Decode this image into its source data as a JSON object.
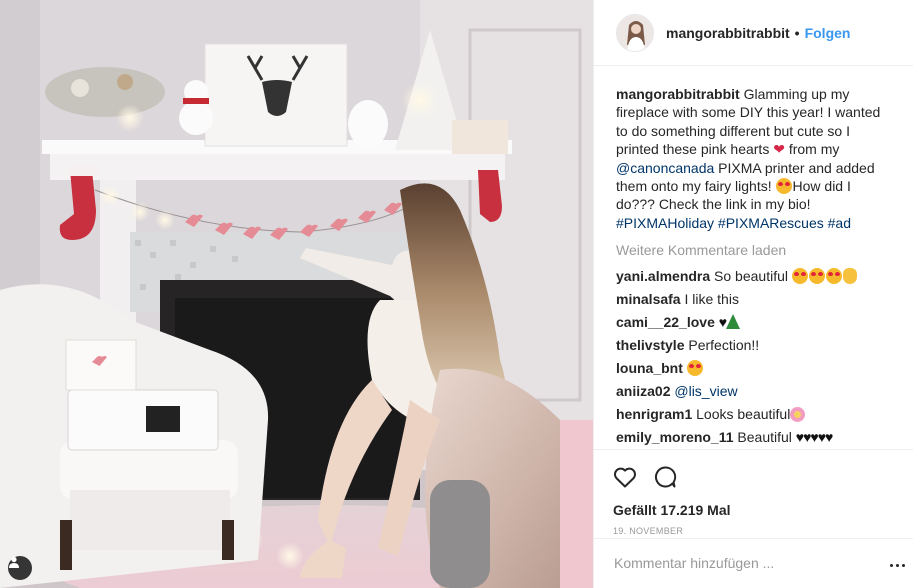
{
  "post": {
    "username": "mangorabbitrabbit",
    "follow_label": "Folgen",
    "separator": "•"
  },
  "caption": {
    "username": "mangorabbitrabbit",
    "text_1": "Glamming up my fireplace with some DIY this year! I wanted to do something different but cute so I printed these pink hearts ",
    "text_2": " from my ",
    "mention": "@canoncanada",
    "text_3": " PIXMA printer and added them onto my fairy lights! ",
    "text_4": "How did I do??? Check the link in my bio! ",
    "hashtags": "#PIXMAHoliday #PIXMARescues #ad"
  },
  "load_more_label": "Weitere Kommentare laden",
  "comments": [
    {
      "username": "yani.almendra",
      "text": "So beautiful"
    },
    {
      "username": "minalsafa",
      "text": "I like this"
    },
    {
      "username": "cami__22_love",
      "text": ""
    },
    {
      "username": "thelivstyle",
      "text": "Perfection!!"
    },
    {
      "username": "louna_bnt",
      "text": ""
    },
    {
      "username": "aniiza02",
      "mention": "@lis_view"
    },
    {
      "username": "henrigram1",
      "text": "Looks beautiful"
    },
    {
      "username": "emily_moreno_11",
      "text": "Beautiful",
      "hearts": "♥♥♥♥♥"
    }
  ],
  "likes_label": "Gefällt 17.219 Mal",
  "date_label": "19. NOVEMBER",
  "add_comment_placeholder": "Kommentar hinzufügen ...",
  "icons": {
    "like": "heart-outline-icon",
    "comment": "speech-bubble-icon",
    "user_tag": "user-tag-icon",
    "options": "more-options-icon"
  },
  "colors": {
    "link_blue": "#3897f0",
    "mention_blue": "#003569",
    "secondary_gray": "#999999",
    "text": "#262626"
  }
}
